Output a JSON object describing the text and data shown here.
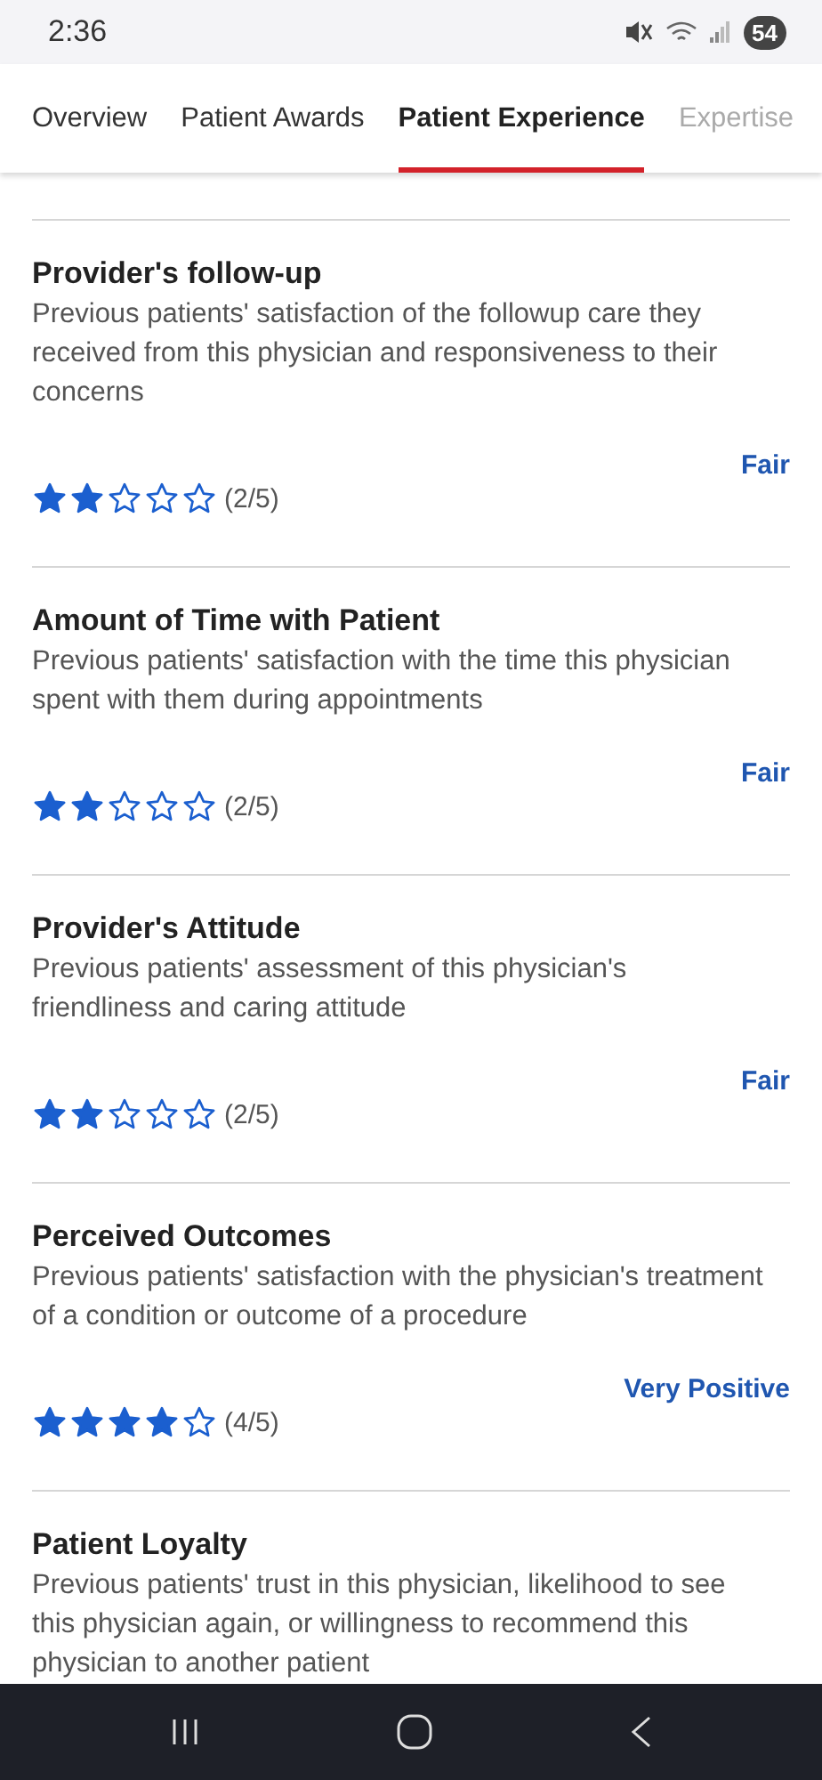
{
  "status_bar": {
    "time": "2:36",
    "battery": "54"
  },
  "tabs": [
    {
      "label": "Overview",
      "selected": false
    },
    {
      "label": "Patient Awards",
      "selected": false
    },
    {
      "label": "Patient Experience",
      "selected": true
    },
    {
      "label": "Expertise",
      "selected": false
    }
  ],
  "sections": [
    {
      "title": "Provider's follow-up",
      "description": "Previous patients' satisfaction of the followup care they received from this physician and responsiveness to their concerns",
      "rating_label": "Fair",
      "stars": 2,
      "score": "(2/5)"
    },
    {
      "title": "Amount of Time with Patient",
      "description": "Previous patients' satisfaction with the time this physician spent with them during appointments",
      "rating_label": "Fair",
      "stars": 2,
      "score": "(2/5)"
    },
    {
      "title": "Provider's Attitude",
      "description": "Previous patients' assessment of this physician's friendliness and caring attitude",
      "rating_label": "Fair",
      "stars": 2,
      "score": "(2/5)"
    },
    {
      "title": "Perceived Outcomes",
      "description": "Previous patients' satisfaction with the physician's treatment of a condition or outcome of a procedure",
      "rating_label": "Very Positive",
      "stars": 4,
      "score": "(4/5)"
    },
    {
      "title": "Patient Loyalty",
      "description": "Previous patients' trust in this physician, likelihood to see this physician again, or willingness to recommend this physician to another patient"
    }
  ]
}
